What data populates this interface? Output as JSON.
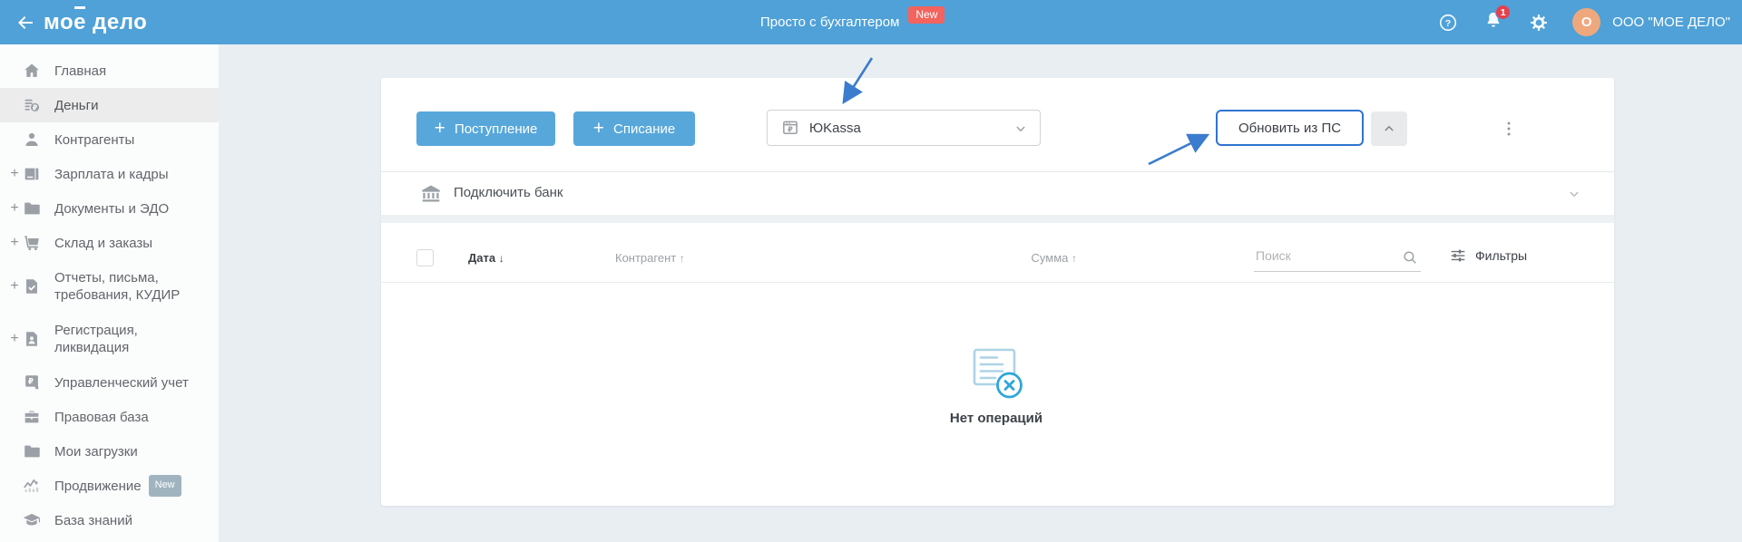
{
  "topbar": {
    "logo": {
      "prefix": "мо",
      "accent_letter": "е",
      "suffix": "дело"
    },
    "promo": {
      "label": "Просто с бухгалтером",
      "badge": "New"
    },
    "notification_count": "1",
    "account": {
      "initial": "O",
      "name": "ООО \"МОЕ ДЕЛО\""
    }
  },
  "sidebar": {
    "expand_symbol": "+",
    "items": [
      {
        "label": "Главная",
        "icon": "home",
        "expandable": false,
        "active": false
      },
      {
        "label": "Деньги",
        "icon": "money",
        "expandable": false,
        "active": true
      },
      {
        "label": "Контрагенты",
        "icon": "person",
        "expandable": false,
        "active": false
      },
      {
        "label": "Зарплата и кадры",
        "icon": "wallet",
        "expandable": true,
        "active": false
      },
      {
        "label": "Документы и ЭДО",
        "icon": "folder",
        "expandable": true,
        "active": false
      },
      {
        "label": "Склад и заказы",
        "icon": "cart",
        "expandable": true,
        "active": false
      },
      {
        "label": "Отчеты, письма, требования, КУДИР",
        "icon": "doc-check",
        "expandable": true,
        "active": false
      },
      {
        "label": "Регистрация, ликвидация",
        "icon": "doc-person",
        "expandable": true,
        "active": false
      },
      {
        "label": "Управленческий учет",
        "icon": "p-ruble",
        "expandable": false,
        "active": false
      },
      {
        "label": "Правовая база",
        "icon": "briefcase",
        "expandable": false,
        "active": false
      },
      {
        "label": "Мои загрузки",
        "icon": "folder",
        "expandable": false,
        "active": false
      },
      {
        "label": "Продвижение",
        "icon": "pulse",
        "expandable": false,
        "active": false,
        "badge": "New"
      },
      {
        "label": "База знаний",
        "icon": "grad-cap",
        "expandable": false,
        "active": false
      }
    ]
  },
  "toolbar": {
    "plus_symbol": "+",
    "income_button": "Поступление",
    "expense_button": "Списание",
    "wallet_select": {
      "value": "ЮKassa",
      "icon": "cash-register"
    },
    "update_button": "Обновить из ПС",
    "bank_row": {
      "label": "Подключить банк"
    }
  },
  "table": {
    "columns": [
      {
        "label": "Дата",
        "arrow": "↓"
      },
      {
        "label": "Контрагент",
        "arrow": "↑"
      },
      {
        "label": "Сумма",
        "arrow": "↑"
      }
    ],
    "search_placeholder": "Поиск",
    "filters_label": "Фильтры",
    "empty_label": "Нет операций"
  },
  "icons": {
    "back": "arrow-left",
    "help": "help",
    "bell": "bell",
    "gear": "gear",
    "select_chevron": "chevron-down",
    "collapse": "chevron-up",
    "menu": "kebab",
    "bank": "bank",
    "bank_chevron": "chevron-down",
    "search": "search",
    "filters": "sliders"
  },
  "colors": {
    "topbar_blue": "#4fa1d8",
    "button_blue": "#57a7db",
    "update_border_blue": "#2f74d0",
    "promo_badge_red": "#f4635d",
    "bell_badge_red": "#e5414e",
    "avatar_orange": "#efa87e",
    "annotation_arrow_blue": "#3b7cce",
    "empty_icon_light": "#aed3e6",
    "empty_icon_strong": "#2ea7d8",
    "background": "#e9eef2"
  }
}
